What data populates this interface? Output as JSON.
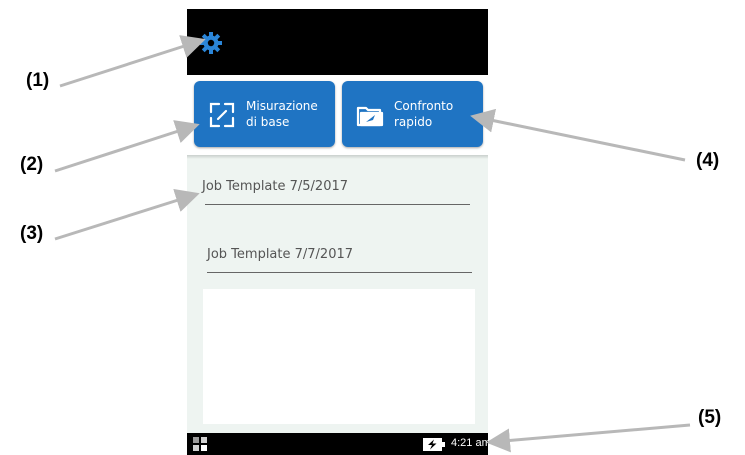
{
  "callouts": [
    "(1)",
    "(2)",
    "(3)",
    "(4)",
    "(5)"
  ],
  "top_bar": {
    "settings_icon": "gear-icon"
  },
  "buttons": [
    {
      "line1": "Misurazione",
      "line2": "di base",
      "icon": "measure-icon"
    },
    {
      "line1": "Confronto",
      "line2": "rapido",
      "icon": "folder-compare-icon"
    }
  ],
  "job_templates": [
    "Job Template 7/5/2017",
    "Job Template 7/7/2017"
  ],
  "status_bar": {
    "time": "4:21 am",
    "icons": [
      "grid-icon",
      "battery-charging-icon"
    ]
  },
  "colors": {
    "button_blue": "#1f74c3",
    "gear_blue": "#2b86d9",
    "background": "#eef4f1"
  }
}
